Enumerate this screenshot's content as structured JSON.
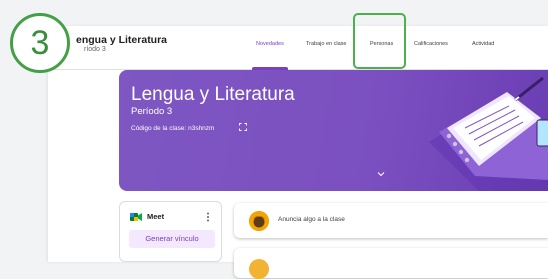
{
  "step": {
    "number": "3"
  },
  "header": {
    "course_title": "engua y Literatura",
    "course_subtitle": "ríodo 3",
    "tabs": [
      {
        "label": "Novedades",
        "active": true
      },
      {
        "label": "Trabajo en clase",
        "active": false
      },
      {
        "label": "Personas",
        "active": false,
        "highlighted": true
      },
      {
        "label": "Calificaciones",
        "active": false
      },
      {
        "label": "Actividad",
        "active": false
      }
    ]
  },
  "banner": {
    "title": "Lengua y Literatura",
    "period": "Período 3",
    "class_code": "Código de la clase: n3shnzm"
  },
  "meet": {
    "label": "Meet",
    "button": "Generar vínculo"
  },
  "stream": {
    "announce_placeholder": "Anuncia algo a la clase"
  },
  "colors": {
    "accent": "#7b3fc0",
    "banner": "#7e57c2",
    "highlight": "#4caf50"
  },
  "icons": [
    "fullscreen-icon",
    "chevron-down-icon",
    "meet-icon",
    "more-vert-icon"
  ]
}
